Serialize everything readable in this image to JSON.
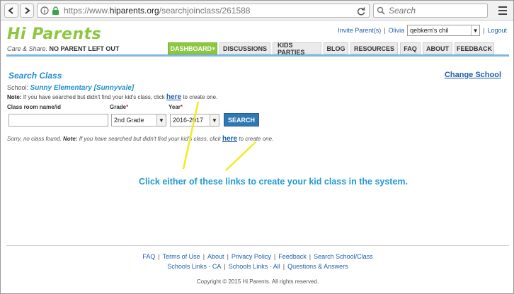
{
  "browser": {
    "url_scheme": "https://www.",
    "url_host": "hiparents.org",
    "url_path": "/searchjoinclass/261588",
    "search_placeholder": "Search"
  },
  "site": {
    "logo": "Hi Parents",
    "tagline_italic": "Care & Share.",
    "tagline_bold": "NO PARENT LEFT OUT",
    "toplinks": {
      "invite": "Invite Parent(s)",
      "user": "Olivia",
      "user_select": "qebkem's chil",
      "logout": "Logout"
    },
    "tabs": [
      "DASHBOARD",
      "DISCUSSIONS",
      "KIDS PARTIES",
      "BLOG",
      "RESOURCES",
      "FAQ",
      "ABOUT",
      "FEEDBACK"
    ]
  },
  "content": {
    "heading": "Search Class",
    "change_school": "Change School",
    "school_label": "School:",
    "school_name": "Sunny Elementary [Sunnyvale]",
    "note_label": "Note:",
    "note_text_1": "If you have searched but didn't find your kid's class, click",
    "here": "here",
    "note_text_2": "to create one.",
    "classroom_label": "Class room name/id",
    "classroom_value": "",
    "grade_label": "Grade",
    "grade_value": "2nd Grade",
    "year_label": "Year",
    "year_value": "2016-2017",
    "required_mark": "*",
    "search_button": "SEARCH",
    "sorry_text_1": "Sorry, no class found.",
    "sorry_note_label": "Note:",
    "sorry_text_2": "If you have searched but didn't find your kid's class, click",
    "sorry_here": "here",
    "sorry_text_3": "to create one."
  },
  "annotation": {
    "text": "Click either of these links to create your kid class in the system.",
    "color": "#1f9ad6",
    "arrow_color": "#f0ec1e"
  },
  "footer": {
    "row1": [
      "FAQ",
      "Terms of Use",
      "About",
      "Privacy Policy",
      "Feedback",
      "Search School/Class"
    ],
    "row2": [
      "Schools Links - CA",
      "Schools Links - All",
      "Questions & Answers"
    ],
    "copyright": "Copyright © 2015 Hi Parents. All rights reserved."
  }
}
